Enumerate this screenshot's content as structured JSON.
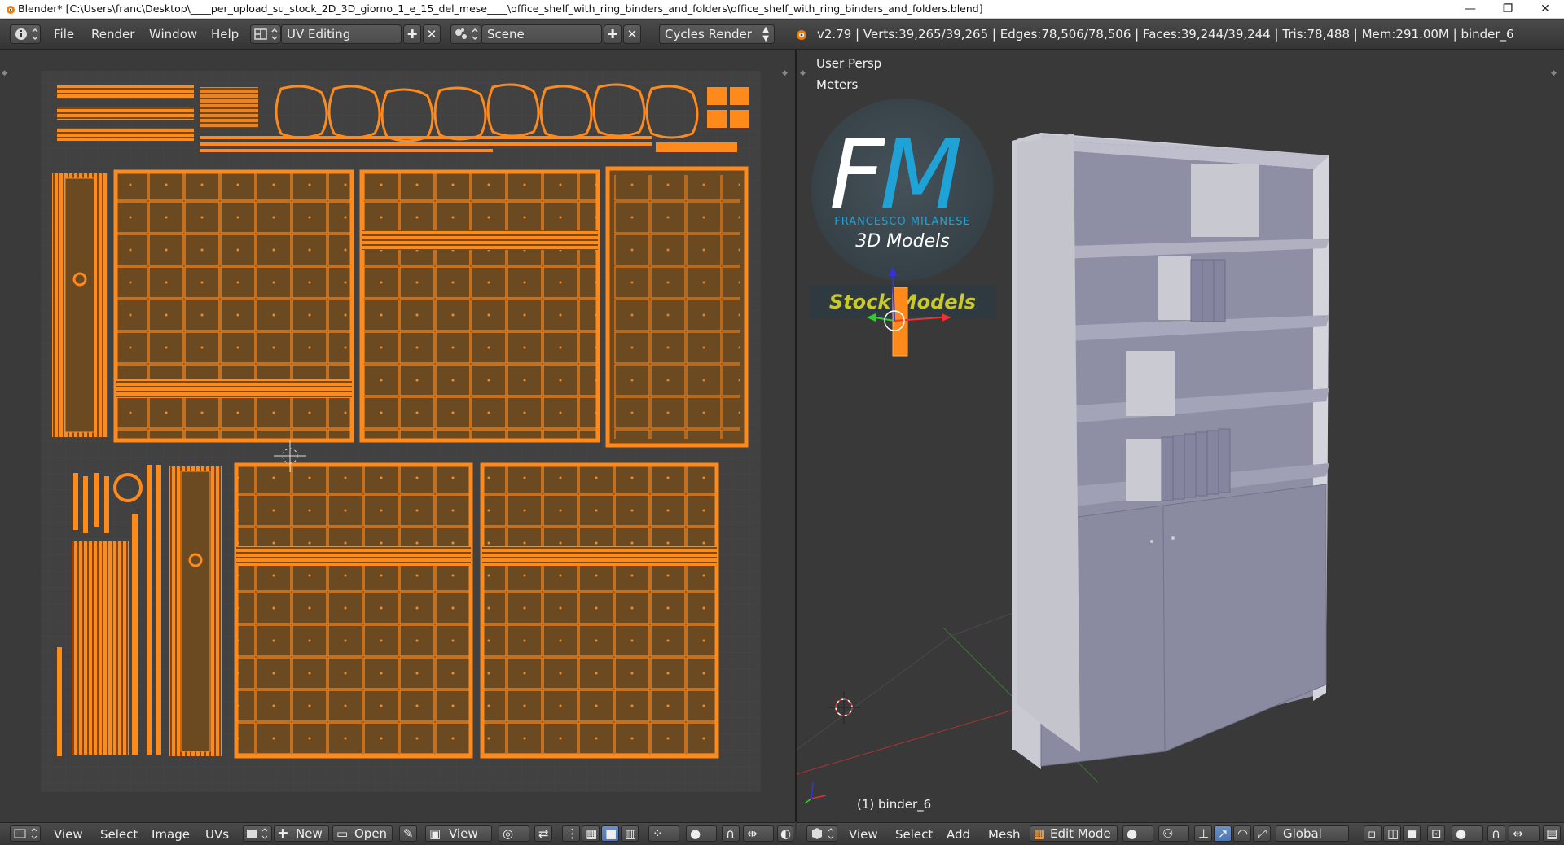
{
  "window": {
    "title": "Blender* [C:\\Users\\franc\\Desktop\\____per_upload_su_stock_2D_3D_giorno_1_e_15_del_mese____\\office_shelf_with_ring_binders_and_folders\\office_shelf_with_ring_binders_and_folders.blend]",
    "minimize": "—",
    "restore": "❐",
    "close": "✕"
  },
  "info_header": {
    "menus": [
      "File",
      "Render",
      "Window",
      "Help"
    ],
    "screen_layout": "UV Editing",
    "scene": "Scene",
    "render_engine": "Cycles Render",
    "stats": "v2.79 | Verts:39,265/39,265 | Edges:78,506/78,506 | Faces:39,244/39,244 | Tris:78,488 | Mem:291.00M | binder_6"
  },
  "viewport": {
    "view_name": "User Persp",
    "units": "Meters",
    "object_label": "(1) binder_6",
    "logo": {
      "initials_f": "F",
      "initials_m": "M",
      "name": "FRANCESCO MILANESE",
      "subtitle": "3D Models",
      "badge": "Stock Models"
    }
  },
  "uv_footer": {
    "menus": [
      "View",
      "Select",
      "Image",
      "UVs"
    ],
    "new_label": "New",
    "open_label": "Open",
    "view_label": "View"
  },
  "view3d_footer": {
    "menus": [
      "View",
      "Select",
      "Add",
      "Mesh"
    ],
    "mode": "Edit Mode",
    "orientation": "Global"
  },
  "colors": {
    "uv_orange": "#ff8a1c",
    "uv_face_fill": "#6b4a22",
    "accent_blue": "#1fa3d6",
    "stock_yellow": "#c8c92a"
  }
}
